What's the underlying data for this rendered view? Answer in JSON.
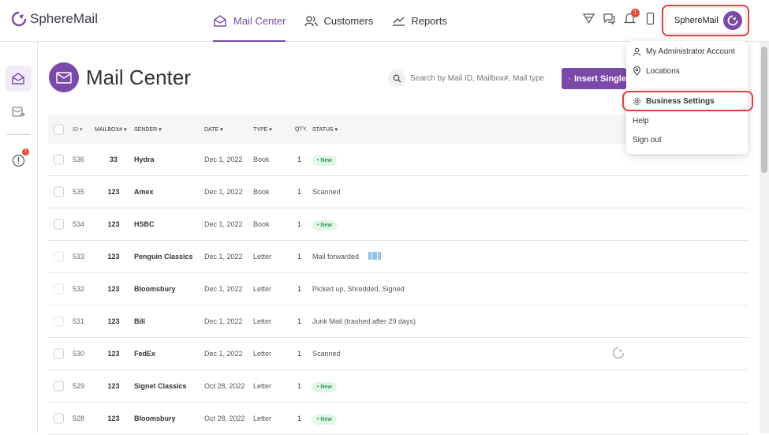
{
  "app": {
    "name": "SphereMail"
  },
  "nav": {
    "items": [
      {
        "label": "Mail Center",
        "icon": "mail-center-icon",
        "active": true
      },
      {
        "label": "Customers",
        "icon": "customers-icon",
        "active": false
      },
      {
        "label": "Reports",
        "icon": "reports-icon",
        "active": false
      }
    ]
  },
  "topbar": {
    "notification_count": "1",
    "user_label": "SphereMail"
  },
  "sidebar": {
    "alert_count": "1"
  },
  "page": {
    "title": "Mail Center"
  },
  "search": {
    "placeholder": "Search by Mail ID, Mailbox#, Mail type"
  },
  "insert_button": {
    "label": "Insert Single"
  },
  "table": {
    "headers": {
      "id": "ID",
      "mailbox": "MAILBOX#",
      "sender": "SENDER",
      "date": "DATE",
      "type": "TYPE",
      "qty": "QTY.",
      "status": "STATUS"
    },
    "rows": [
      {
        "id": "536",
        "mailbox": "33",
        "sender": "Hydra",
        "date": "Dec 1, 2022",
        "type": "Book",
        "qty": "1",
        "status": "New",
        "pill": true
      },
      {
        "id": "535",
        "mailbox": "123",
        "sender": "Amex",
        "date": "Dec 1, 2022",
        "type": "Book",
        "qty": "1",
        "status": "Scanned",
        "pill": false
      },
      {
        "id": "534",
        "mailbox": "123",
        "sender": "HSBC",
        "date": "Dec 1, 2022",
        "type": "Book",
        "qty": "1",
        "status": "New",
        "pill": true
      },
      {
        "id": "533",
        "mailbox": "123",
        "sender": "Penguin Classics",
        "date": "Dec 1, 2022",
        "type": "Letter",
        "qty": "1",
        "status": "Mail forwarded",
        "pill": false
      },
      {
        "id": "532",
        "mailbox": "123",
        "sender": "Bloomsbury",
        "date": "Dec 1, 2022",
        "type": "Letter",
        "qty": "1",
        "status": "Picked up,  Shredded,  Signed",
        "pill": false
      },
      {
        "id": "531",
        "mailbox": "123",
        "sender": "Bill",
        "date": "Dec 1, 2022",
        "type": "Letter",
        "qty": "1",
        "status": "Junk Mail (trashed after 29 days)",
        "pill": false
      },
      {
        "id": "530",
        "mailbox": "123",
        "sender": "FedEx",
        "date": "Dec 1, 2022",
        "type": "Letter",
        "qty": "1",
        "status": "Scanned",
        "pill": false
      },
      {
        "id": "529",
        "mailbox": "123",
        "sender": "Signet Classics",
        "date": "Oct 28, 2022",
        "type": "Letter",
        "qty": "1",
        "status": "New",
        "pill": true
      },
      {
        "id": "528",
        "mailbox": "123",
        "sender": "Bloomsbury",
        "date": "Oct 28, 2022",
        "type": "Letter",
        "qty": "1",
        "status": "New",
        "pill": true
      }
    ]
  },
  "dropdown": {
    "items": [
      {
        "label": "My Administrator Account",
        "icon": "user-icon"
      },
      {
        "label": "Locations",
        "icon": "location-pin-icon"
      },
      {
        "label": "Business Settings",
        "icon": "gear-icon"
      },
      {
        "label": "Help"
      },
      {
        "label": "Sign out"
      }
    ]
  },
  "colors": {
    "brand": "#7b4aa8",
    "highlight": "#d9423a",
    "new_pill": "#e2f6e8"
  }
}
